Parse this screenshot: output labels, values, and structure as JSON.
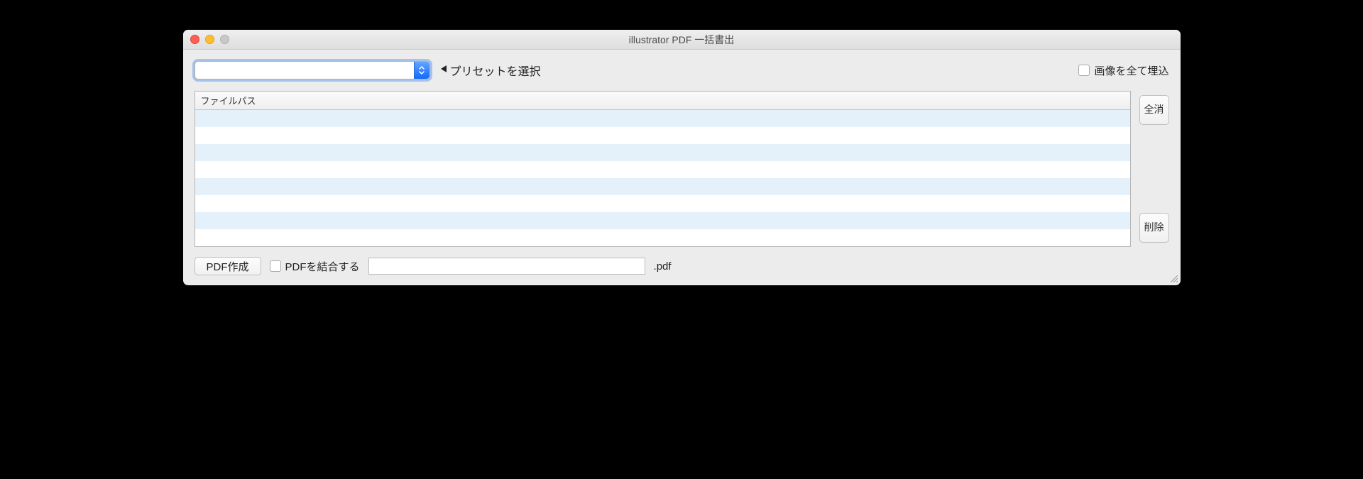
{
  "window": {
    "title": "illustrator PDF 一括書出"
  },
  "toprow": {
    "preset_value": "",
    "preset_hint": "プリセットを選択",
    "embed_images_label": "画像を全て埋込"
  },
  "filelist": {
    "header": "ファイルパス"
  },
  "side": {
    "clear_all": "全消",
    "delete": "削除"
  },
  "bottom": {
    "create_pdf": "PDF作成",
    "merge_label": "PDFを結合する",
    "filename_value": "",
    "extension": ".pdf"
  }
}
